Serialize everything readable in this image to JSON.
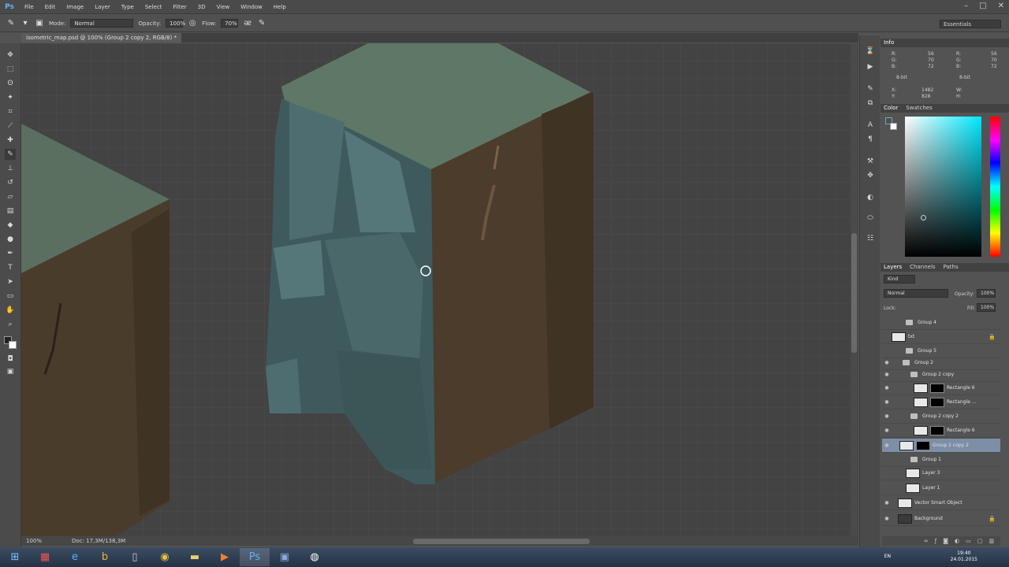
{
  "app": {
    "logo": "Ps"
  },
  "menu": [
    "File",
    "Edit",
    "Image",
    "Layer",
    "Type",
    "Select",
    "Filter",
    "3D",
    "View",
    "Window",
    "Help"
  ],
  "options": {
    "mode_label": "Mode:",
    "mode_value": "Normal",
    "opacity_label": "Opacity:",
    "opacity_value": "100%",
    "flow_label": "Flow:",
    "flow_value": "70%",
    "workspace": "Essentials"
  },
  "document": {
    "tab_title": "isometric_map.psd @ 100% (Group 2 copy 2, RGB/8) *",
    "zoom": "100%",
    "doc_size": "Doc: 17,3M/138,3M"
  },
  "info": {
    "header": "Info",
    "r": "R:",
    "g": "G:",
    "b": "B:",
    "rv": "56",
    "gv": "70",
    "bv": "72",
    "r2v": "56",
    "g2v": "70",
    "b2v": "72",
    "bit1": "8-bit",
    "bit2": "8-bit",
    "x": "X:",
    "y": "Y:",
    "xv": "1482",
    "yv": "828",
    "w": "W:",
    "h": "H:"
  },
  "color_panel": {
    "tabs": [
      "Color",
      "Swatches"
    ]
  },
  "layers_panel": {
    "tabs": [
      "Layers",
      "Channels",
      "Paths"
    ],
    "kind": "Kind",
    "blend": "Normal",
    "opacity_label": "Opacity:",
    "opacity_value": "100%",
    "lock_label": "Lock:",
    "fill_label": "Fill:",
    "fill_value": "100%",
    "layers": [
      {
        "name": "Group 4"
      },
      {
        "name": "txt"
      },
      {
        "name": "Group 5"
      },
      {
        "name": "Group 2"
      },
      {
        "name": "Group 2 copy"
      },
      {
        "name": "Rectangle 6"
      },
      {
        "name": "Rectangle ..."
      },
      {
        "name": "Group 2 copy 2"
      },
      {
        "name": "Rectangle 6"
      },
      {
        "name": "Group 2 copy 2"
      },
      {
        "name": "Group 1"
      },
      {
        "name": "Layer 3"
      },
      {
        "name": "Layer 1"
      },
      {
        "name": "Vector Smart Object"
      },
      {
        "name": "Background"
      }
    ]
  },
  "taskbar": {
    "time": "19:40",
    "date": "24.01.2015",
    "lang": "EN"
  }
}
